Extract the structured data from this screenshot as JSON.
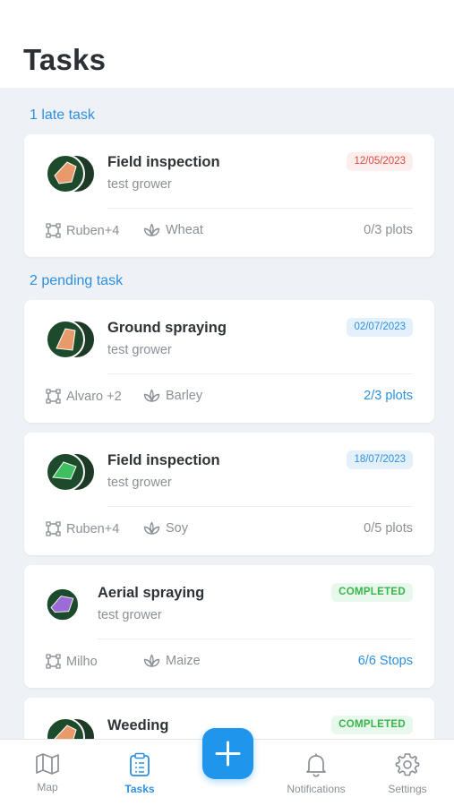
{
  "header": {
    "title": "Tasks"
  },
  "sections": {
    "late": "1 late task",
    "pending": "2 pending task"
  },
  "tasks": [
    {
      "title": "Field inspection",
      "grower": "test grower",
      "badge": "12/05/2023",
      "people": "Ruben+4",
      "crop": "Wheat",
      "progress": "0/3 plots",
      "field_color": "#e89a6b"
    },
    {
      "title": "Ground spraying",
      "grower": "test grower",
      "badge": "02/07/2023",
      "people": "Alvaro +2",
      "crop": "Barley",
      "progress": "2/3 plots",
      "field_color": "#e89a6b"
    },
    {
      "title": "Field inspection",
      "grower": "test grower",
      "badge": "18/07/2023",
      "people": "Ruben+4",
      "crop": "Soy",
      "progress": "0/5 plots",
      "field_color": "#3fbf5f"
    },
    {
      "title": "Aerial spraying",
      "grower": "test grower",
      "badge": "COMPLETED",
      "people": "Milho",
      "crop": "Maize",
      "progress": "6/6 Stops",
      "field_color": "#9b6bd6"
    },
    {
      "title": "Weeding",
      "badge": "COMPLETED",
      "field_color": "#e89a6b"
    }
  ],
  "nav": {
    "map": "Map",
    "tasks": "Tasks",
    "notifications": "Notifications",
    "settings": "Settings"
  },
  "colors": {
    "accent": "#2d8fe0",
    "late": "#e0463c",
    "completed": "#38b54a",
    "fab": "#1f96ec"
  }
}
